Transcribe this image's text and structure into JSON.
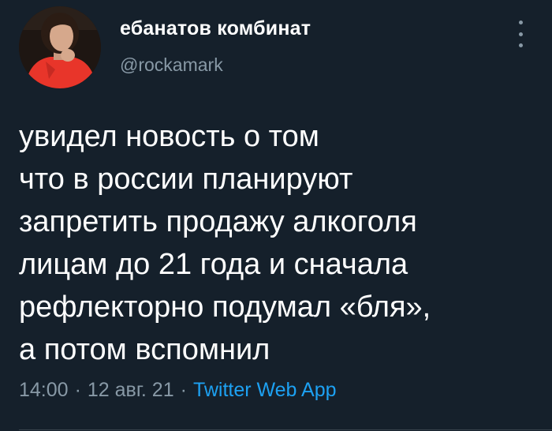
{
  "tweet": {
    "display_name": "ебанатов комбинат",
    "handle": "@rockamark",
    "text_lines": [
      "увидел новость о том",
      "что в россии планируют",
      "запретить продажу алкоголя",
      "лицам до 21 года и сначала",
      "рефлекторно подумал «бля»,",
      "а потом вспомнил"
    ],
    "time": "14:00",
    "separator": "·",
    "date": "12 авг. 21",
    "source": "Twitter Web App"
  },
  "icons": {
    "more": "more-vertical-icon",
    "avatar": "avatar"
  },
  "colors": {
    "background": "#15202b",
    "text_primary": "#ffffff",
    "text_secondary": "#8899a6",
    "accent": "#1da1f2",
    "avatar_shirt": "#e8352a"
  }
}
